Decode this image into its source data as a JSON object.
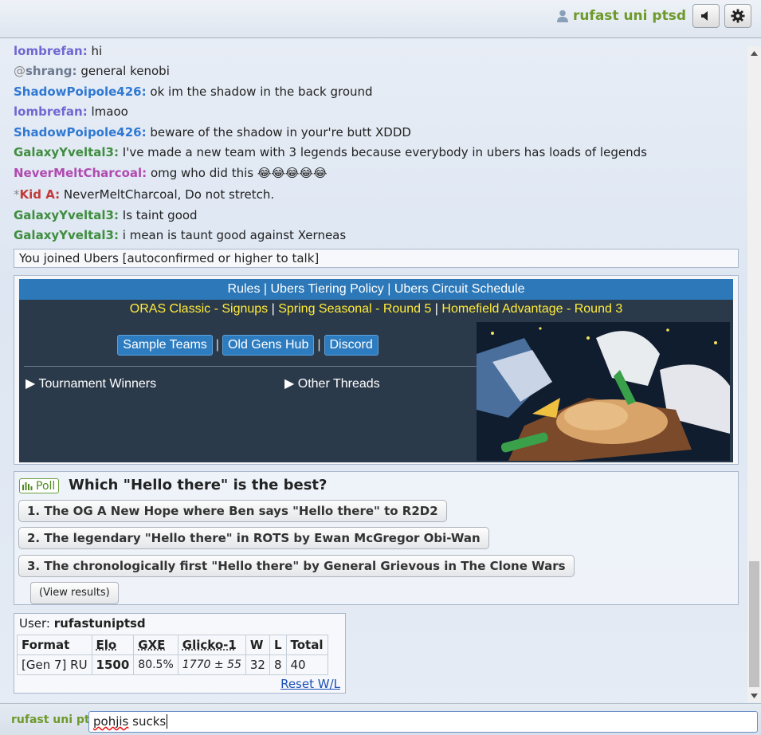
{
  "header": {
    "username": "rufast uni ptsd"
  },
  "colors": {
    "lombrefan": "#7167d3",
    "shrang": "#6b7a8f",
    "ShadowPoipole426": "#2f78d3",
    "GalaxyYveltal3": "#3f8d3f",
    "NeverMeltCharcoal": "#b04ab0",
    "KidA": "#c43a3a",
    "self": "#6e9a2a"
  },
  "messages": [
    {
      "sym": "",
      "user": "lombrefan",
      "color": "#7167d3",
      "text": "hi"
    },
    {
      "sym": "@",
      "user": "shrang",
      "color": "#6b7a8f",
      "text": "general kenobi"
    },
    {
      "sym": "",
      "user": "ShadowPoipole426",
      "color": "#2f78d3",
      "text": "ok im the shadow in the back ground"
    },
    {
      "sym": "",
      "user": "lombrefan",
      "color": "#7167d3",
      "text": "lmaoo"
    },
    {
      "sym": "",
      "user": "ShadowPoipole426",
      "color": "#2f78d3",
      "text": "beware of the shadow in your're butt XDDD"
    },
    {
      "sym": "",
      "user": "GalaxyYveltal3",
      "color": "#3f8d3f",
      "text": "I've made a new team with 3 legends because everybody in ubers has loads of legends"
    },
    {
      "sym": "",
      "user": "NeverMeltCharcoal",
      "color": "#b04ab0",
      "text": "omg who did this 😂😂😂😂😂"
    },
    {
      "sym": "*",
      "user": "Kid A",
      "color": "#c43a3a",
      "text": "NeverMeltCharcoal, Do not stretch."
    },
    {
      "sym": "",
      "user": "GalaxyYveltal3",
      "color": "#3f8d3f",
      "text": "Is taint good"
    },
    {
      "sym": "",
      "user": "GalaxyYveltal3",
      "color": "#3f8d3f",
      "text": "i mean is taunt good against Xerneas"
    }
  ],
  "notice": "You joined Ubers [autoconfirmed or higher to talk]",
  "infobox": {
    "links_top": [
      "Rules",
      "Ubers Tiering Policy",
      "Ubers Circuit Schedule"
    ],
    "links_tour": [
      "ORAS Classic - Signups",
      "Spring Seasonal - Round 5",
      "Homefield Advantage - Round 3"
    ],
    "buttons": [
      "Sample Teams",
      "Old Gens Hub",
      "Discord"
    ],
    "details": [
      "Tournament Winners",
      "Other Threads"
    ],
    "sep": "|"
  },
  "poll": {
    "tag": "Poll",
    "question": "Which \"Hello there\" is the best?",
    "options": [
      "1. The OG A New Hope where Ben says \"Hello there\" to R2D2",
      "2. The legendary \"Hello there\" in ROTS by Ewan McGregor Obi-Wan",
      "3. The chronologically first \"Hello there\" by General Grievous in The Clone Wars"
    ],
    "results_label": "(View results)"
  },
  "rank": {
    "user_label": "User:",
    "user": "rufastuniptsd",
    "headers": [
      "Format",
      "Elo",
      "GXE",
      "Glicko-1",
      "W",
      "L",
      "Total"
    ],
    "row": {
      "format": "[Gen 7] RU",
      "elo": "1500",
      "gxe": "80.5%",
      "glicko": "1770 ± 55",
      "w": "32",
      "l": "8",
      "total": "40"
    },
    "reset": "Reset W/L"
  },
  "compose": {
    "name": "rufast uni pt",
    "value_misspelled": "pohjis",
    "value_rest": " sucks"
  }
}
